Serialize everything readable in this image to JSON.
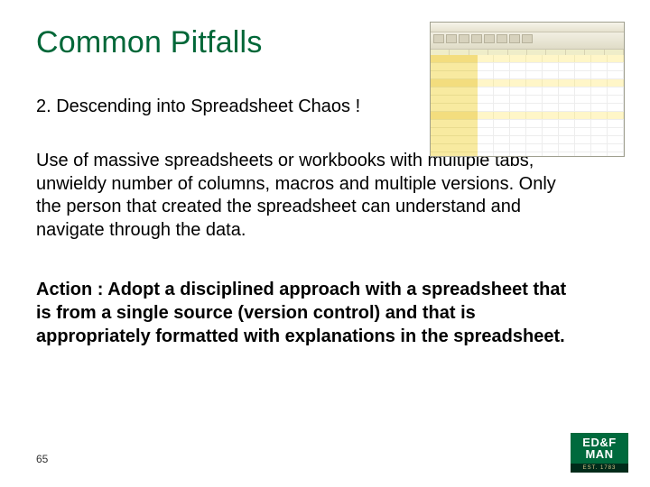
{
  "title": "Common Pitfalls",
  "subheading": "2.  Descending into Spreadsheet Chaos !",
  "body": "Use of massive spreadsheets or workbooks with multiple tabs, unwieldy number of columns, macros and multiple versions. Only the person that created the spreadsheet can understand and navigate through the data.",
  "action": "Action :   Adopt a disciplined approach with a spreadsheet that is from a single source (version control) and that is appropriately formatted with explanations in the spreadsheet.",
  "page_number": "65",
  "logo": {
    "line1": "ED&F",
    "line2": "MAN",
    "est": "EST. 1783"
  }
}
